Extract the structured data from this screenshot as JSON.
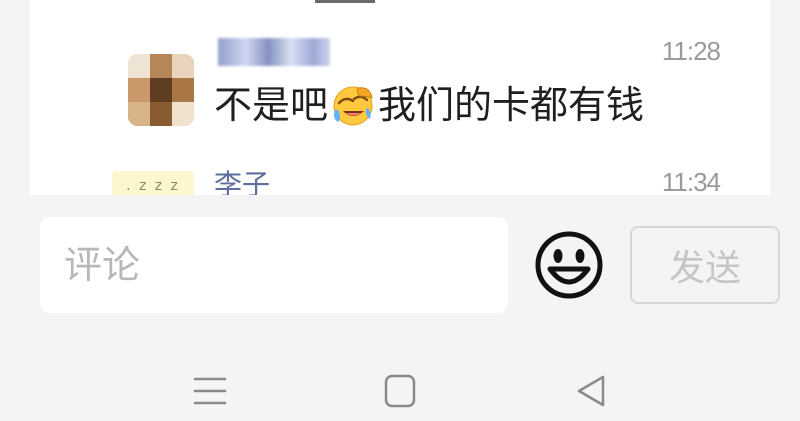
{
  "comments": [
    {
      "nickname": "",
      "time": "11:28",
      "text_before_emoji": "不是吧",
      "emoji": "face-with-hand-over-eyes-laughing-emoji",
      "text_after_emoji": "我们的卡都有钱"
    },
    {
      "nickname": "李子",
      "time": "11:34",
      "avatar_text": ". z z z"
    }
  ],
  "input_bar": {
    "placeholder": "评论",
    "value": "",
    "emoji_button_icon": "smiley-face-icon",
    "send_label": "发送"
  },
  "nav_bar": {
    "icons": [
      "menu-icon",
      "home-square-icon",
      "back-triangle-icon"
    ]
  },
  "colors": {
    "page_background": "#f4f4f4",
    "card_background": "#ffffff",
    "nickname_blue": "#5f6f9d",
    "timestamp_gray": "#9a9a9a",
    "comment_text": "#1f1f1f",
    "placeholder_gray": "#b8b8b8",
    "send_disabled_text": "#c6c6c6",
    "send_border": "#d7d7d7"
  }
}
